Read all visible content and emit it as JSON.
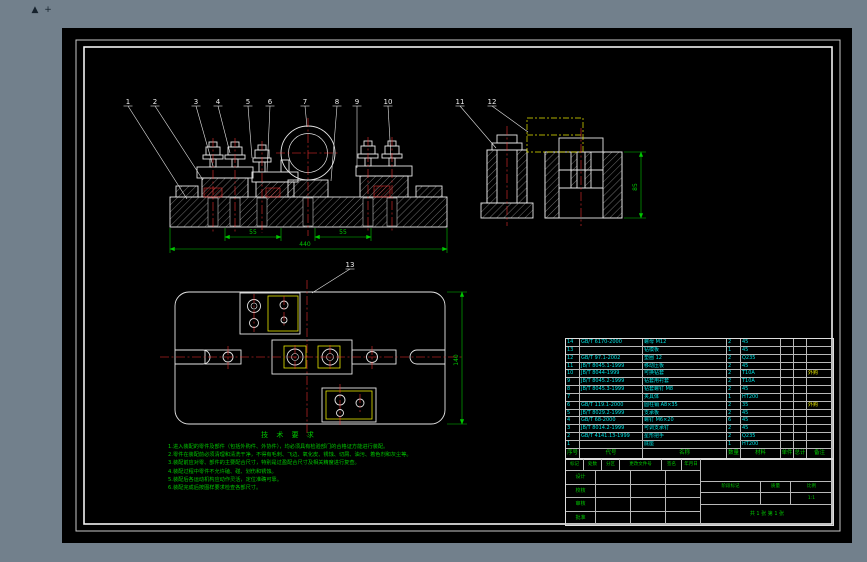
{
  "chrome": {
    "icon1": "▲",
    "icon2": "+"
  },
  "colors": {
    "window_bg": "#72808c",
    "canvas_bg": "#000000",
    "line": "#e6e6e6",
    "dimension": "#00c800",
    "centerline": "#ff3333",
    "highlight": "#e8e800",
    "table_text": "#00e0e0"
  },
  "balloons": {
    "front": [
      "1",
      "2",
      "3",
      "4",
      "5",
      "6",
      "7",
      "8",
      "9",
      "10"
    ],
    "side": [
      "11",
      "12"
    ],
    "plan": [
      "13"
    ]
  },
  "dims": {
    "front_overall": "440",
    "front_small_left": "55",
    "front_small_right": "55",
    "side_height": "85",
    "plan_height": "140"
  },
  "tech": {
    "title": "技 术 要 求",
    "lines": [
      "1.进入装配的零件及部件（包括外购件、外协件），均必须具有检验部门的合格证方能进行装配。",
      "2.零件在装配前必须清理和清洗干净，不得有毛刺、飞边、氧化皮、锈蚀、切屑、油污、着色剂和灰尘等。",
      "3.装配前应对零、部件的主要配合尺寸，特别是过盈配合尺寸及相关精度进行复查。",
      "4.装配过程中零件不允许磕、碰、划伤和锈蚀。",
      "5.装配后各运动机构应动作灵活，定位准确可靠。",
      "6.装配完成后按图样要求检查各部尺寸。"
    ]
  },
  "bom": {
    "headers": [
      "序号",
      "代号",
      "名称",
      "数量",
      "材料",
      "单件",
      "总计",
      "备注"
    ],
    "rows": [
      [
        "14",
        "GB/T 6170-2000",
        "螺母 M12",
        "2",
        "45",
        "",
        "",
        ""
      ],
      [
        "13",
        "",
        "钻模板",
        "1",
        "45",
        "",
        "",
        ""
      ],
      [
        "12",
        "GB/T 97.1-2002",
        "垫圈 12",
        "2",
        "Q235",
        "",
        "",
        ""
      ],
      [
        "11",
        "JB/T 8045.1-1999",
        "移动压板",
        "2",
        "45",
        "",
        "",
        ""
      ],
      [
        "10",
        "JB/T 8044-1999",
        "可换钻套",
        "2",
        "T10A",
        "",
        "",
        "外购"
      ],
      [
        "9",
        "JB/T 8045.2-1999",
        "钻套用衬套",
        "2",
        "T10A",
        "",
        "",
        ""
      ],
      [
        "8",
        "JB/T 8045.3-1999",
        "钻套螺钉 M8",
        "2",
        "45",
        "",
        "",
        ""
      ],
      [
        "7",
        "",
        "夹具体",
        "1",
        "HT200",
        "",
        "",
        ""
      ],
      [
        "6",
        "GB/T 119.1-2000",
        "圆柱销 A8×35",
        "2",
        "35",
        "",
        "",
        "外购"
      ],
      [
        "5",
        "JB/T 8029.2-1999",
        "支承板",
        "2",
        "45",
        "",
        "",
        ""
      ],
      [
        "4",
        "GB/T 68-2000",
        "螺钉 M6×20",
        "6",
        "45",
        "",
        "",
        ""
      ],
      [
        "3",
        "JB/T 8014.2-1999",
        "可调支承钉",
        "2",
        "45",
        "",
        "",
        ""
      ],
      [
        "2",
        "GB/T 4141.13-1999",
        "星形把手",
        "2",
        "Q235",
        "",
        "",
        ""
      ],
      [
        "1",
        "",
        "底座",
        "1",
        "HT200",
        "",
        "",
        ""
      ]
    ]
  },
  "titleblock": {
    "top_labels": [
      "标记",
      "处数",
      "分区",
      "更改文件号",
      "签名",
      "年月日"
    ],
    "left_rows": [
      "设计",
      "校核",
      "审核",
      "批准"
    ],
    "stage_label": "阶段标记",
    "mass_label": "质量",
    "scale_label": "比例",
    "scale_value": "1:1",
    "sheets_text": "共 1 张  第 1 张"
  }
}
